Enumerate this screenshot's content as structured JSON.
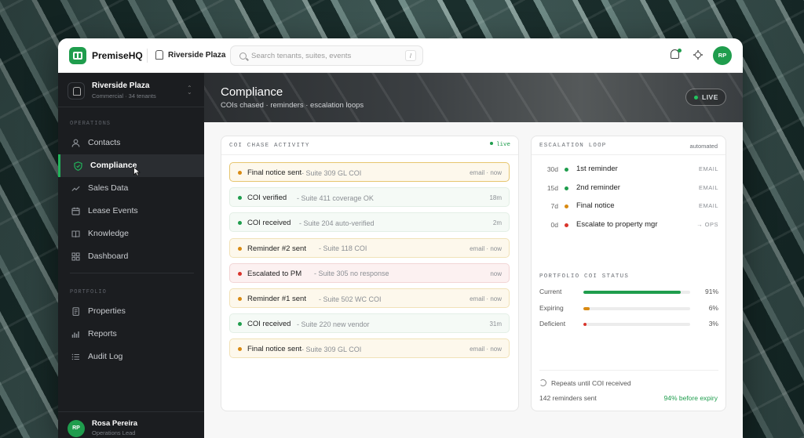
{
  "topbar": {
    "brand": "PremiseHQ",
    "property": "Riverside Plaza",
    "search_placeholder": "Search tenants, suites, events",
    "search_shortcut": "/",
    "avatar_initials": "RP"
  },
  "sidebar": {
    "workspace_name": "Riverside Plaza",
    "workspace_sub": "Commercial · 34 tenants",
    "operations_label": "OPERATIONS",
    "operations": [
      {
        "label": "Contacts",
        "icon": "user-icon"
      },
      {
        "label": "Compliance",
        "icon": "shield-check-icon",
        "active": true
      },
      {
        "label": "Sales Data",
        "icon": "trend-icon"
      },
      {
        "label": "Lease Events",
        "icon": "calendar-icon"
      },
      {
        "label": "Knowledge",
        "icon": "book-icon"
      },
      {
        "label": "Dashboard",
        "icon": "grid-icon"
      }
    ],
    "portfolio_label": "PORTFOLIO",
    "portfolio": [
      {
        "label": "Properties",
        "icon": "document-icon"
      },
      {
        "label": "Reports",
        "icon": "bar-chart-icon"
      },
      {
        "label": "Audit Log",
        "icon": "list-icon"
      }
    ],
    "user": {
      "initials": "RP",
      "name": "Rosa Pereira",
      "role": "Operations Lead"
    }
  },
  "header": {
    "title": "Compliance",
    "subtitle": "COIs chased · reminders · escalation loops",
    "live_label": "LIVE"
  },
  "activity": {
    "title": "COI CHASE ACTIVITY",
    "live_label": "live",
    "rows": [
      {
        "title": "Final notice sent",
        "detail": "- Suite 309 GL COI",
        "time": "email · now",
        "status": "warn"
      },
      {
        "title": "COI verified",
        "detail": "- Suite 411 coverage OK",
        "time": "18m",
        "status": "ok"
      },
      {
        "title": "COI received",
        "detail": "- Suite 204 auto-verified",
        "time": "2m",
        "status": "ok"
      },
      {
        "title": "Reminder #2 sent",
        "detail": "- Suite 118 COI",
        "time": "email · now",
        "status": "warn"
      },
      {
        "title": "Escalated to PM",
        "detail": "- Suite 305 no response",
        "time": "now",
        "status": "bad"
      },
      {
        "title": "Reminder #1 sent",
        "detail": "- Suite 502 WC COI",
        "time": "email · now",
        "status": "warn"
      },
      {
        "title": "COI received",
        "detail": "- Suite 220 new vendor",
        "time": "31m",
        "status": "ok"
      },
      {
        "title": "Final notice sent",
        "detail": "- Suite 309 GL COI",
        "time": "email · now",
        "status": "warn"
      }
    ]
  },
  "escalation": {
    "title": "ESCALATION LOOP",
    "mode": "automated",
    "steps": [
      {
        "day": "30d",
        "label": "1st reminder",
        "channel": "EMAIL",
        "color": "#1f9d4d"
      },
      {
        "day": "15d",
        "label": "2nd reminder",
        "channel": "EMAIL",
        "color": "#1f9d4d"
      },
      {
        "day": "7d",
        "label": "Final notice",
        "channel": "EMAIL",
        "color": "#d98a12"
      },
      {
        "day": "0d",
        "label": "Escalate to property mgr",
        "channel": "→ OPS",
        "color": "#d9342b"
      }
    ],
    "status_title": "PORTFOLIO COI STATUS",
    "status": [
      {
        "label": "Current",
        "percent": 91,
        "display": "91%",
        "color": "#1f9d4d"
      },
      {
        "label": "Expiring",
        "percent": 6,
        "display": "6%",
        "color": "#d98a12"
      },
      {
        "label": "Deficient",
        "percent": 3,
        "display": "3%",
        "color": "#d9342b"
      }
    ],
    "repeat_text": "Repeats until COI received",
    "sent_text": "142 reminders sent",
    "before_expiry": "94% before expiry"
  },
  "colors": {
    "accent": "#1f9d4d",
    "warn": "#d98a12",
    "danger": "#d9342b"
  }
}
